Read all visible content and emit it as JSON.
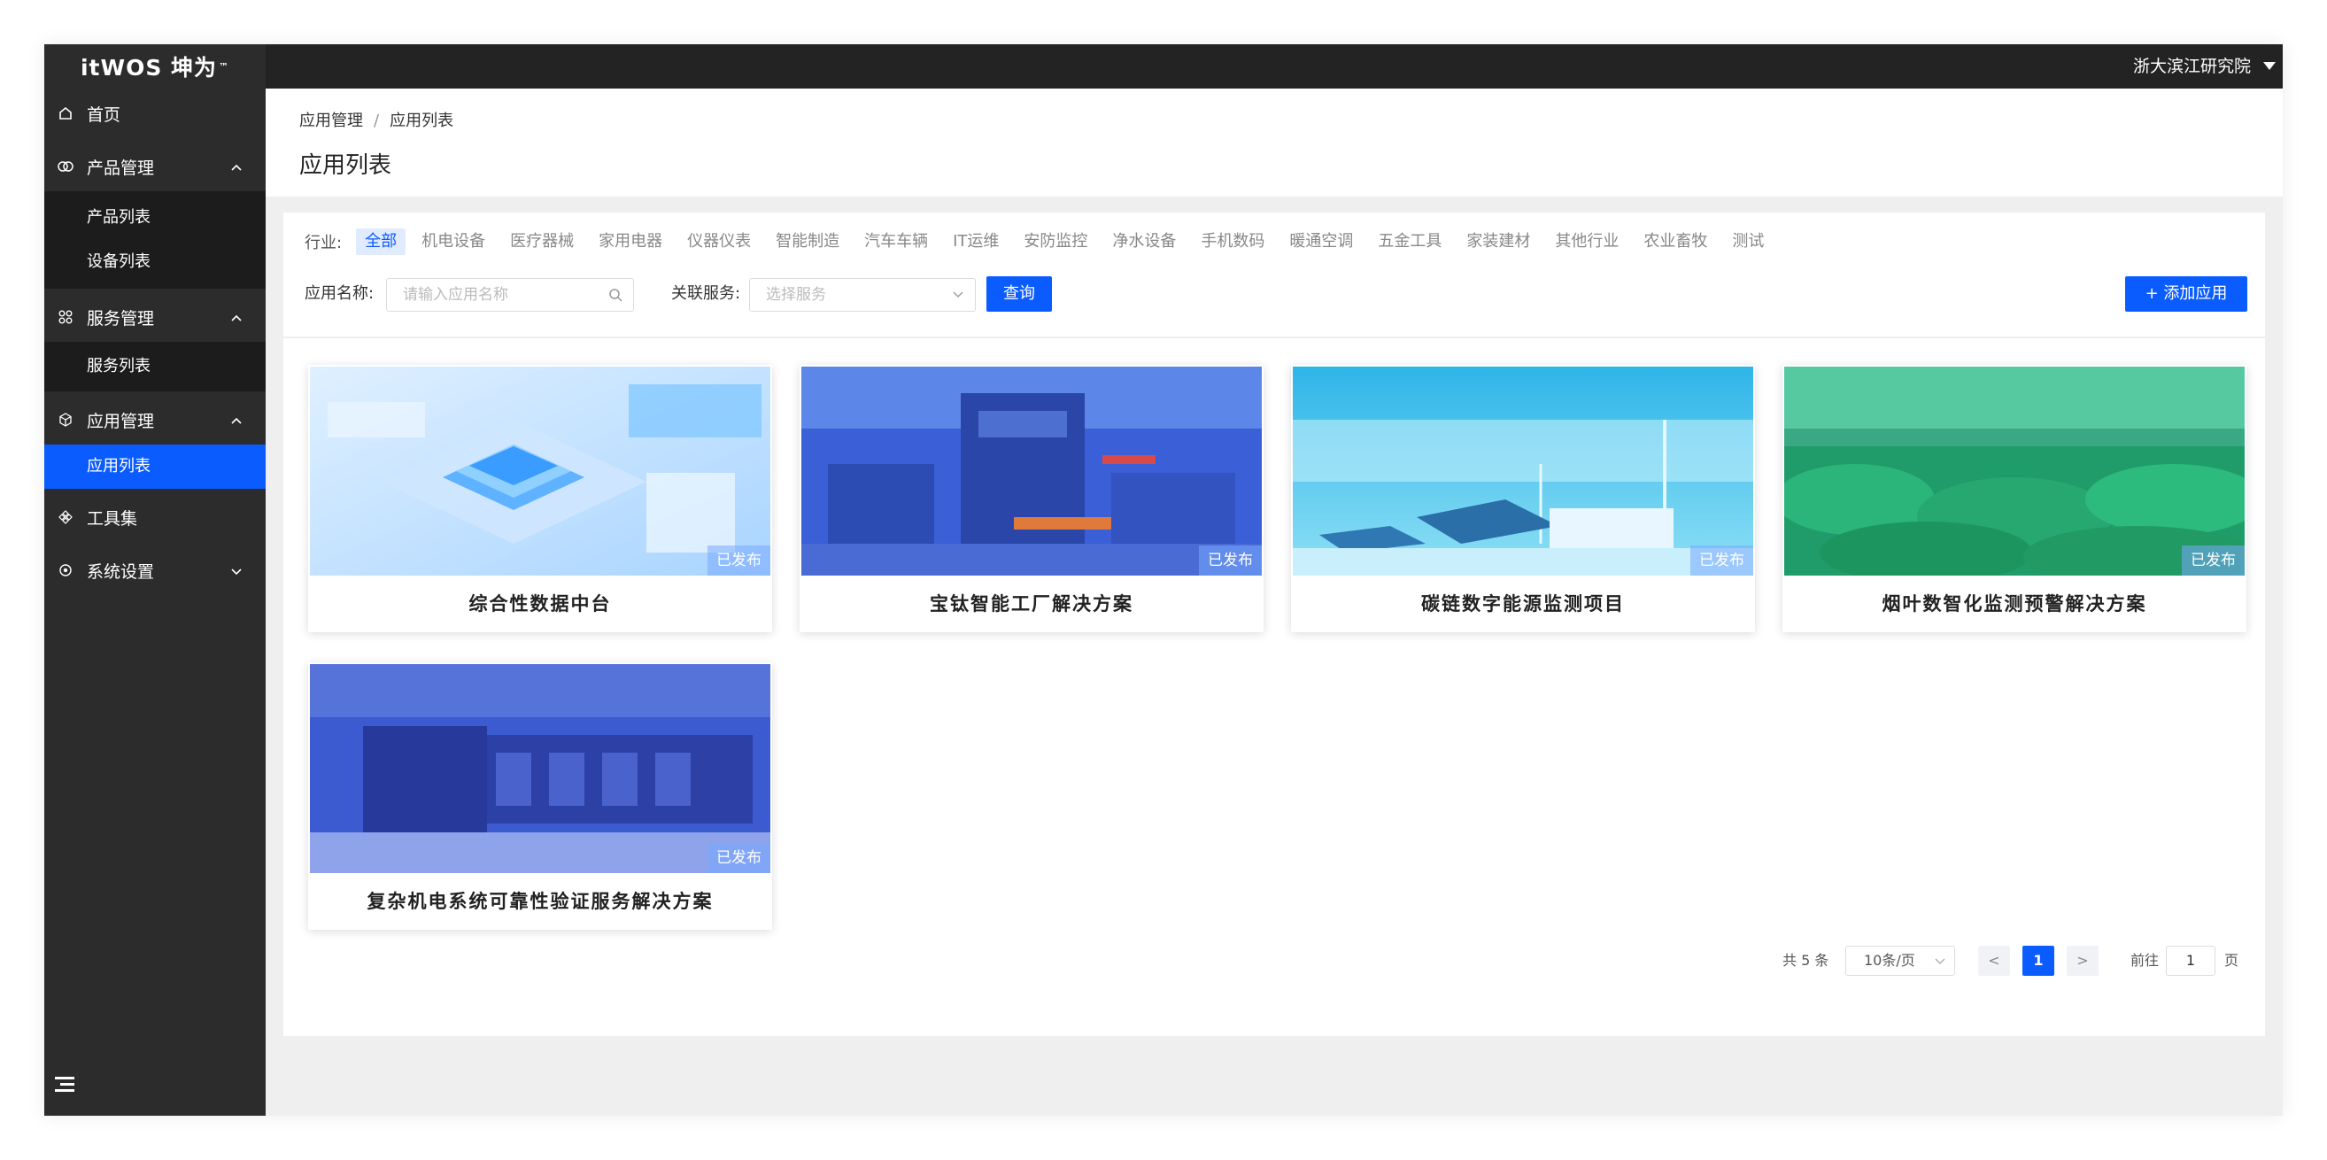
{
  "app": {
    "logo": "itWOS 坤为",
    "logo_tm": "™",
    "org": "浙大滨江研究院"
  },
  "sidebar": {
    "home": "首页",
    "groups": [
      {
        "label": "产品管理",
        "items": [
          "产品列表",
          "设备列表"
        ]
      },
      {
        "label": "服务管理",
        "items": [
          "服务列表"
        ]
      },
      {
        "label": "应用管理",
        "items": [
          "应用列表"
        ]
      }
    ],
    "tools": "工具集",
    "settings": "系统设置",
    "active_item": "应用列表"
  },
  "breadcrumb": {
    "parent": "应用管理",
    "separator": "/",
    "current": "应用列表"
  },
  "page_title": "应用列表",
  "filters": {
    "industry_label": "行业:",
    "industries": [
      "全部",
      "机电设备",
      "医疗器械",
      "家用电器",
      "仪器仪表",
      "智能制造",
      "汽车车辆",
      "IT运维",
      "安防监控",
      "净水设备",
      "手机数码",
      "暖通空调",
      "五金工具",
      "家装建材",
      "其他行业",
      "农业畜牧",
      "测试"
    ],
    "active_industry": "全部",
    "app_name_label": "应用名称:",
    "app_name_placeholder": "请输入应用名称",
    "service_label": "关联服务:",
    "service_placeholder": "选择服务",
    "query_button": "查询",
    "add_button": "+ 添加应用"
  },
  "cards": [
    {
      "title": "综合性数据中台",
      "status": "已发布"
    },
    {
      "title": "宝钛智能工厂解决方案",
      "status": "已发布"
    },
    {
      "title": "碳链数字能源监测项目",
      "status": "已发布"
    },
    {
      "title": "烟叶数智化监测预警解决方案",
      "status": "已发布"
    },
    {
      "title": "复杂机电系统可靠性验证服务解决方案",
      "status": "已发布"
    }
  ],
  "pagination": {
    "total": "共 5 条",
    "page_size": "10条/页",
    "current_page": "1",
    "prev": "<",
    "next": ">",
    "goto_prefix": "前往",
    "goto_value": "1",
    "goto_suffix": "页"
  },
  "colors": {
    "primary": "#0b5cff",
    "sidebar_bg": "#2c2c2c",
    "topbar_bg": "#232323"
  }
}
